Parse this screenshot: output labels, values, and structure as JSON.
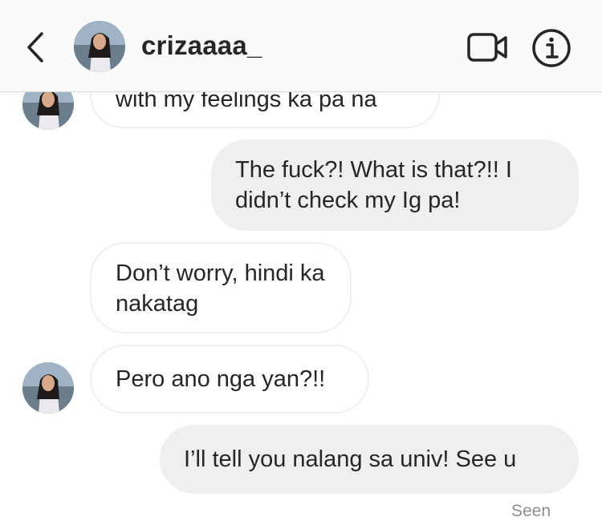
{
  "header": {
    "username": "crizaaaa_",
    "back_icon": "chevron-left-icon",
    "video_icon": "video-camera-icon",
    "info_icon": "info-icon"
  },
  "messages": [
    {
      "direction": "incoming",
      "text": "with my feelings ka pa na",
      "avatar": true
    },
    {
      "direction": "outgoing",
      "text": "The fuck?! What is that?!! I didn’t check my Ig pa!"
    },
    {
      "direction": "incoming",
      "text": "Don’t worry, hindi ka nakatag",
      "avatar": false
    },
    {
      "direction": "incoming",
      "text": "Pero ano nga yan?!!",
      "avatar": true
    },
    {
      "direction": "outgoing",
      "text": "I’ll tell you nalang sa univ! See u"
    }
  ],
  "status": {
    "seen": "Seen"
  },
  "colors": {
    "header_bg": "#fafafa",
    "outgoing_bubble": "#efefef",
    "incoming_border": "#efefef",
    "text": "#262626",
    "muted": "#8e8e8e"
  }
}
